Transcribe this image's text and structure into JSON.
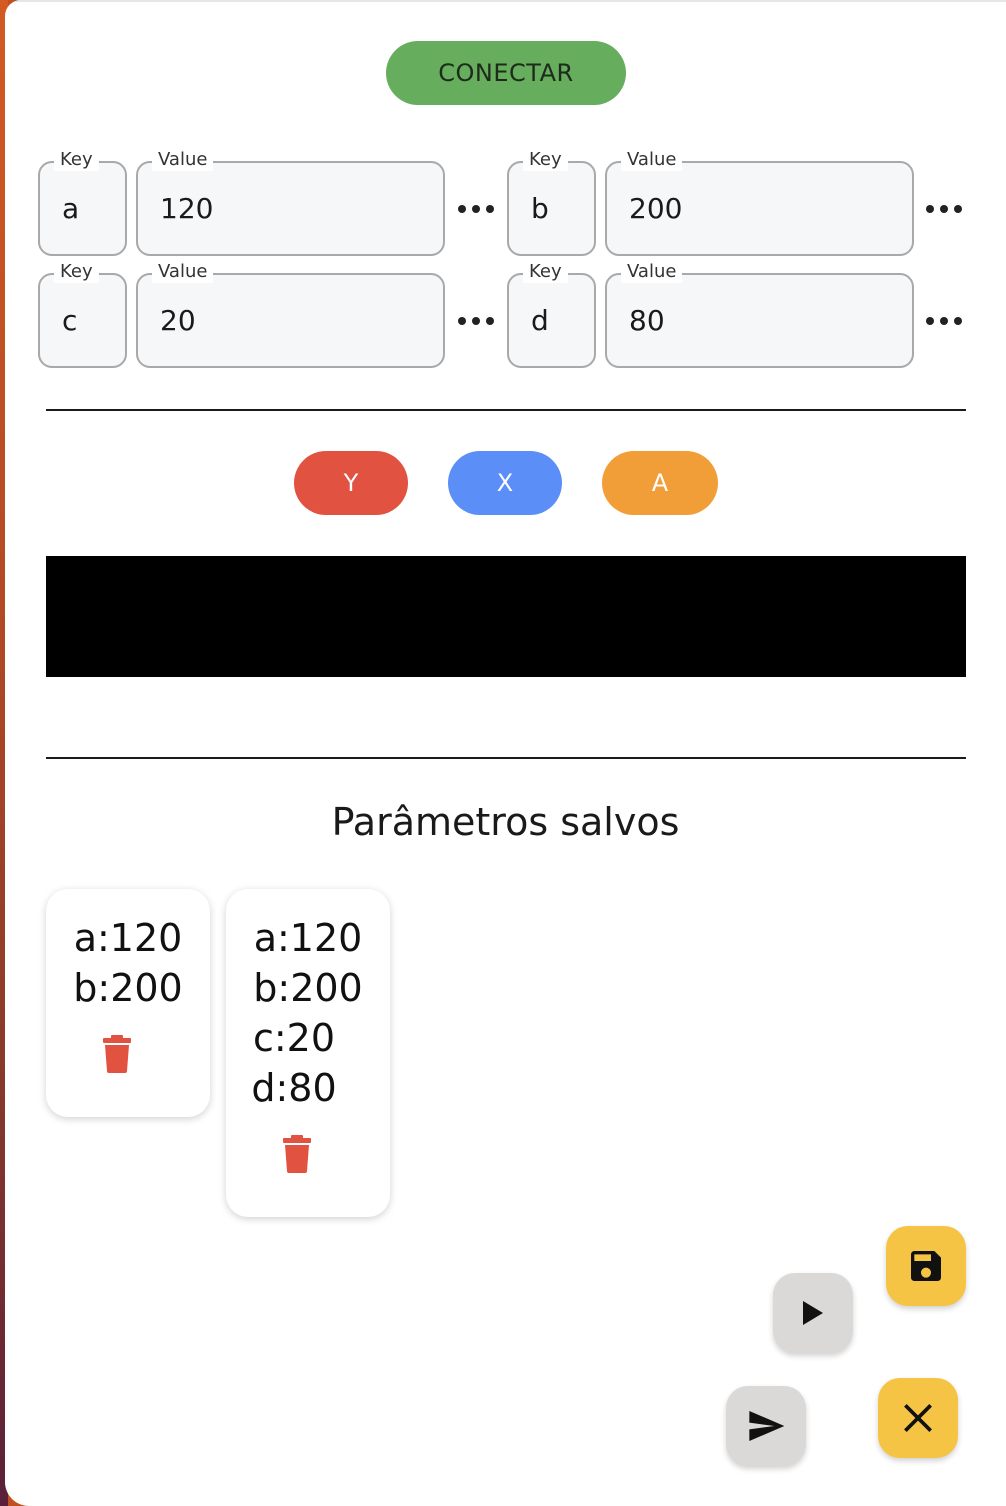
{
  "header": {
    "connect_label": "CONECTAR"
  },
  "params": [
    {
      "key_label": "Key",
      "key": "a",
      "value_label": "Value",
      "value": "120"
    },
    {
      "key_label": "Key",
      "key": "b",
      "value_label": "Value",
      "value": "200"
    },
    {
      "key_label": "Key",
      "key": "c",
      "value_label": "Value",
      "value": "20"
    },
    {
      "key_label": "Key",
      "key": "d",
      "value_label": "Value",
      "value": "80"
    }
  ],
  "buttons": [
    {
      "label": "Y",
      "color": "#e15241"
    },
    {
      "label": "X",
      "color": "#5b8ef6"
    },
    {
      "label": "A",
      "color": "#f19e38"
    }
  ],
  "saved": {
    "title": "Parâmetros salvos",
    "cards": [
      {
        "lines": [
          "a:120",
          "b:200"
        ]
      },
      {
        "lines": [
          "a:120",
          "b:200",
          "c:20",
          "d:80"
        ]
      }
    ]
  },
  "fabs": {
    "save": {
      "icon": "save-icon",
      "color": "#f6c445"
    },
    "play": {
      "icon": "play-icon",
      "color": "#dbd9d8"
    },
    "send": {
      "icon": "send-icon",
      "color": "#dbd9d8"
    },
    "close": {
      "icon": "close-icon",
      "color": "#f6c445"
    }
  },
  "colors": {
    "connect": "#66ad5d",
    "trash": "#e15241"
  }
}
